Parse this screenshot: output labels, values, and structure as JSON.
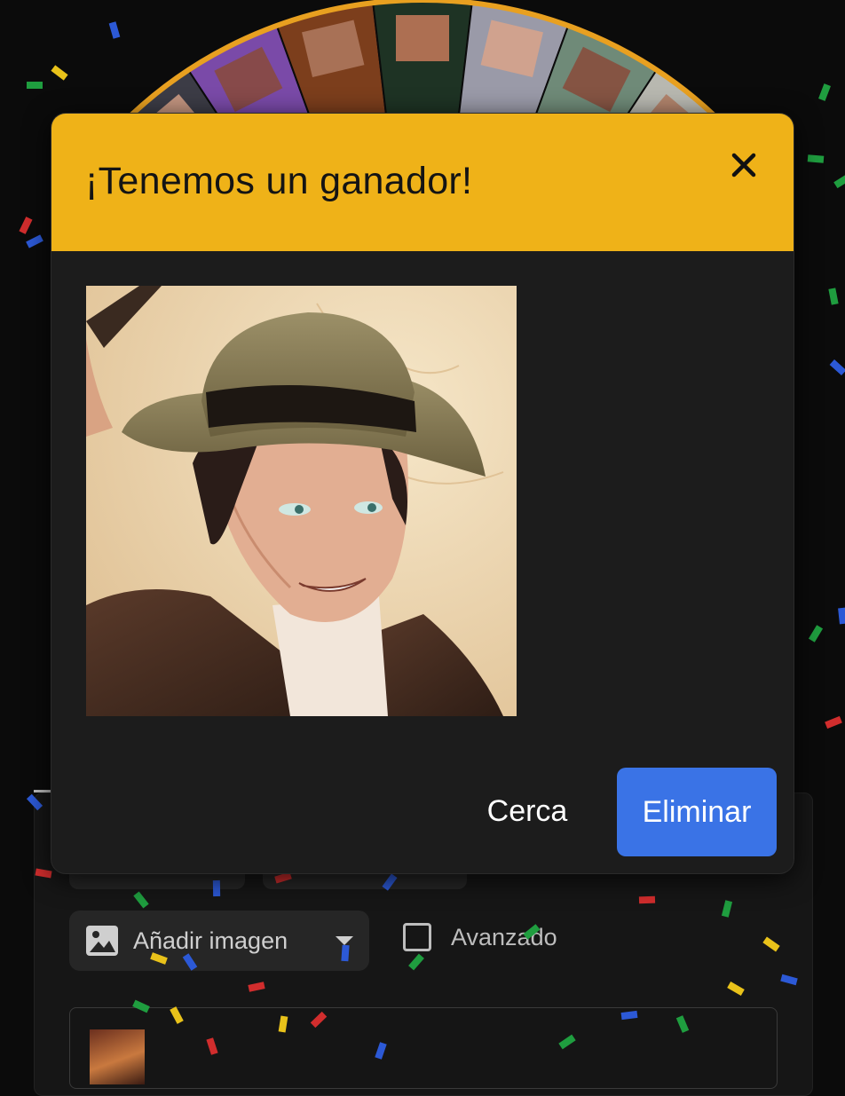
{
  "modal": {
    "title": "¡Tenemos un ganador!",
    "close_button": "Cerca",
    "remove_button": "Eliminar",
    "header_color": "#efb218",
    "remove_button_color": "#3a73e6"
  },
  "background": {
    "add_image_label": "Añadir imagen",
    "advanced_label": "Avanzado",
    "wheel_segment_colors": [
      "#6a3a1a",
      "#3c3c46",
      "#7a4aa8",
      "#7c3e1c",
      "#1e3324",
      "#9a9aa8",
      "#6f8a78",
      "#b8b8b0",
      "#3e7f9a"
    ]
  },
  "icons": {
    "close": "close-icon",
    "image": "image-icon",
    "dropdown": "chevron-down-icon",
    "checkbox": "checkbox-icon"
  }
}
